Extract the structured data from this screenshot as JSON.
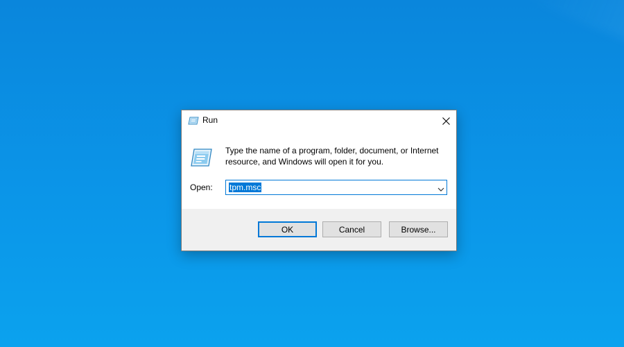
{
  "desktop": {
    "background_color": "#0b95e8"
  },
  "dialog": {
    "title": "Run",
    "title_icon": "run-icon",
    "close_icon": "close-icon",
    "description": "Type the name of a program, folder, document, or Internet resource, and Windows will open it for you.",
    "open_label": "Open:",
    "open_value": "tpm.msc",
    "dropdown_icon": "chevron-down-icon",
    "buttons": {
      "ok": "OK",
      "cancel": "Cancel",
      "browse": "Browse..."
    },
    "accent_color": "#0078d7"
  }
}
